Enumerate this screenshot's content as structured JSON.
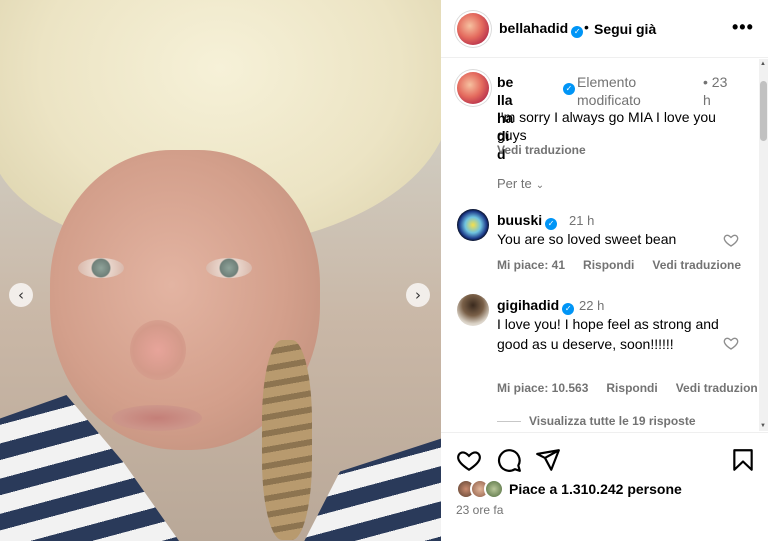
{
  "post": {
    "username": "bellahadid",
    "follow_status": "Segui già",
    "separator": "•",
    "more_label": "•••"
  },
  "photo": {
    "prev_icon": "‹",
    "next_icon": "›"
  },
  "caption": {
    "username_line1": "bellahadi",
    "username_line2": "d",
    "edited_label": "Elemento modificato",
    "time": "• 23 h",
    "text": "I'm sorry I always go MIA I love you guys",
    "translate": "Vedi traduzione"
  },
  "sort": {
    "label": "Per te",
    "icon": "chevron-down"
  },
  "comments": [
    {
      "username": "buuski",
      "time": "21 h",
      "text": "You are so loved sweet bean",
      "likes": "Mi piace: 41",
      "reply": "Rispondi",
      "translate": "Vedi traduzione"
    },
    {
      "username": "gigihadid",
      "time": "22 h",
      "text": "I love you! I hope feel as strong and good as u deserve, soon!!!!!!",
      "likes": "Mi piace: 10.563",
      "reply": "Rispondi",
      "translate": "Vedi traduzione"
    }
  ],
  "view_replies": "Visualizza tutte le 19 risposte",
  "footer": {
    "likes_text": "Piace a 1.310.242 persone",
    "time_ago": "23 ore fa"
  },
  "colors": {
    "verified": "#0095f6",
    "secondary_text": "#737373",
    "border": "#efefef"
  }
}
